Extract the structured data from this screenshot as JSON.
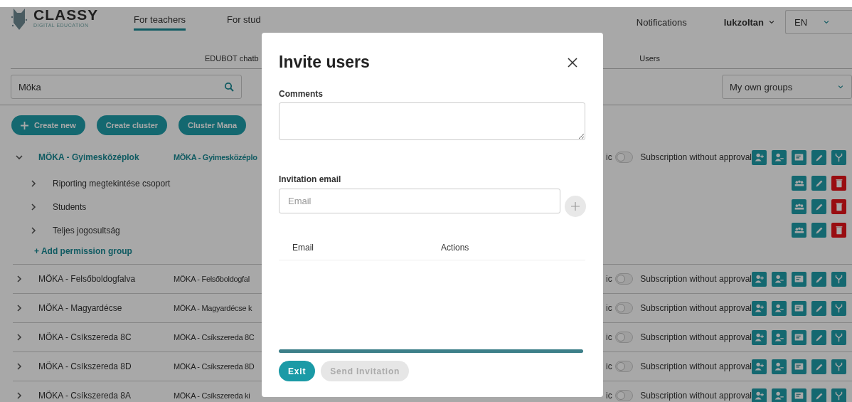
{
  "header": {
    "logo": {
      "name": "CLASSY",
      "tagline": "DIGITAL EDUCATION"
    },
    "nav": [
      {
        "label": "For teachers",
        "selected": true
      },
      {
        "label": "For stud",
        "selected": false
      }
    ],
    "notifications": "Notifications",
    "user": "lukzoltan",
    "language": "EN"
  },
  "subnav": [
    {
      "label": "EDUBOT chatb",
      "selected": false
    },
    {
      "label": "Users",
      "selected": false
    }
  ],
  "search": {
    "value": "Möka"
  },
  "filter": "My own groups",
  "actions": [
    {
      "label": "Create new",
      "kind": "add"
    },
    {
      "label": "Create cluster",
      "kind": "plain"
    },
    {
      "label": "Cluster Mana",
      "kind": "plain"
    }
  ],
  "groups": [
    {
      "name": "MÖKA - Gyimesközéplok",
      "code": "MÖKA - Gyimesközéplo",
      "expanded": true,
      "public_label": "ic",
      "public_on": false,
      "subscription": "Subscription without approval",
      "children": [
        {
          "name": "Riporting megtekintése csoport",
          "expanded": false
        },
        {
          "name": "Students",
          "expanded": false
        },
        {
          "name": "Teljes jogosultság",
          "expanded": false
        }
      ],
      "add_label": "+ Add permission group"
    },
    {
      "name": "MÖKA - Felsőboldogfalva",
      "code": "MÖKA - Felsőboldogfal",
      "expanded": false,
      "public_label": "ic",
      "public_on": false,
      "subscription": "Subscription without approval"
    },
    {
      "name": "MÖKA - Magyardécse",
      "code": "MÖKA - Magyardécse k",
      "expanded": false,
      "public_label": "ic",
      "public_on": false,
      "subscription": "Subscription without approval"
    },
    {
      "name": "MÖKA - Csíkszereda 8C",
      "code": "MÖKA - Csíkszereda 8C",
      "expanded": false,
      "public_label": "ic",
      "public_on": false,
      "subscription": "Subscription without approval"
    },
    {
      "name": "MÖKA - Csíkszereda 8D",
      "code": "MÖKA - Csíkszereda 8D",
      "expanded": false,
      "public_label": "ic",
      "public_on": false,
      "subscription": "Subscription without approval"
    },
    {
      "name": "MÖKA - Csíkszereda 8A",
      "code": "MÖKA - Csíkszereda ki",
      "expanded": false,
      "public_label": "ic",
      "public_on": false,
      "subscription": "Subscription without approval"
    }
  ],
  "modal": {
    "title": "Invite users",
    "comments_label": "Comments",
    "email_label": "Invitation email",
    "email_placeholder": "Email",
    "columns": [
      "Email",
      "Actions"
    ],
    "buttons": [
      {
        "label": "Exit",
        "disabled": false
      },
      {
        "label": "Send Invitation",
        "disabled": true
      }
    ]
  }
}
